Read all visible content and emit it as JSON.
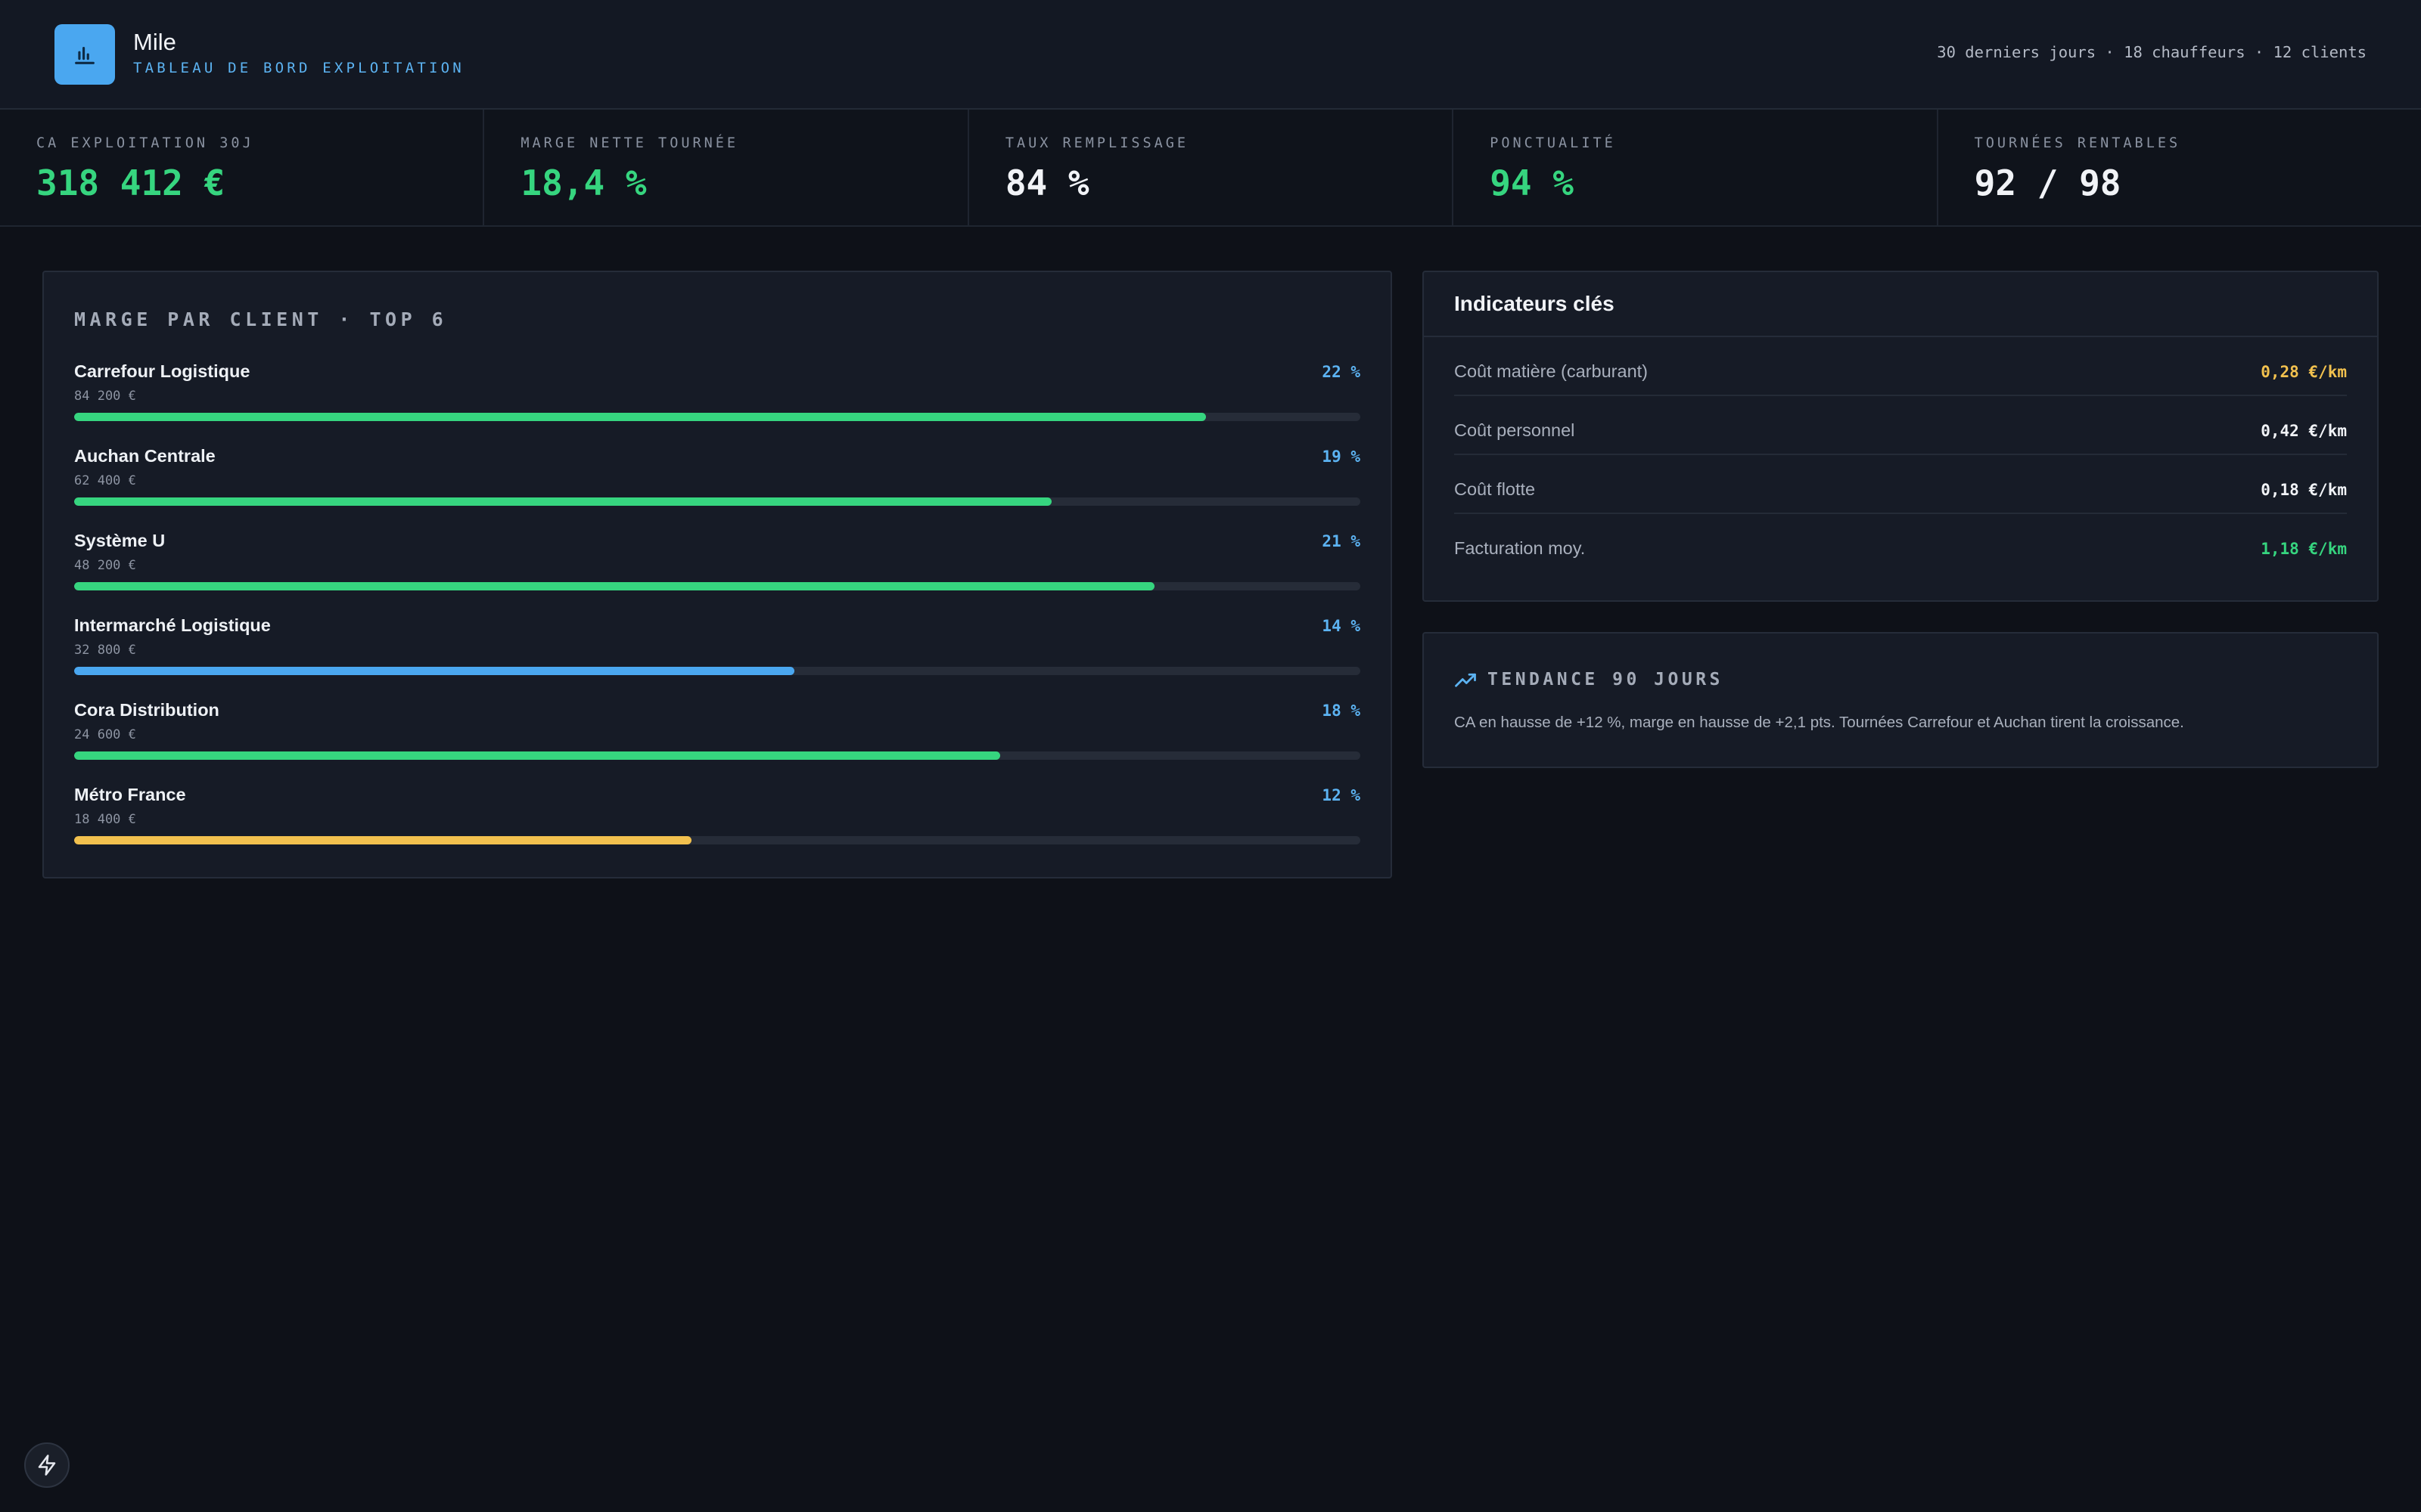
{
  "header": {
    "app_name": "Mile",
    "subtitle": "TABLEAU DE BORD EXPLOITATION",
    "meta": "30 derniers jours · 18 chauffeurs · 12 clients",
    "logo_icon": "bar-chart-icon"
  },
  "kpis": [
    {
      "label": "CA EXPLOITATION 30J",
      "value": "318 412 €",
      "accent": true
    },
    {
      "label": "MARGE NETTE TOURNÉE",
      "value": "18,4 %",
      "accent": true
    },
    {
      "label": "TAUX REMPLISSAGE",
      "value": "84 %",
      "accent": false
    },
    {
      "label": "PONCTUALITÉ",
      "value": "94 %",
      "accent": true
    },
    {
      "label": "TOURNÉES RENTABLES",
      "value": "92 / 98",
      "accent": false
    }
  ],
  "margin_panel": {
    "title": "MARGE PAR CLIENT · TOP 6",
    "clients": [
      {
        "name": "Carrefour Logistique",
        "amount": "84 200 €",
        "pct": "22 %",
        "level": 0.88,
        "color": "#36d57f"
      },
      {
        "name": "Auchan Centrale",
        "amount": "62 400 €",
        "pct": "19 %",
        "level": 0.76,
        "color": "#36d57f"
      },
      {
        "name": "Système U",
        "amount": "48 200 €",
        "pct": "21 %",
        "level": 0.84,
        "color": "#36d57f"
      },
      {
        "name": "Intermarché Logistique",
        "amount": "32 800 €",
        "pct": "14 %",
        "level": 0.56,
        "color": "#4aa7f0"
      },
      {
        "name": "Cora Distribution",
        "amount": "24 600 €",
        "pct": "18 %",
        "level": 0.72,
        "color": "#36d57f"
      },
      {
        "name": "Métro France",
        "amount": "18 400 €",
        "pct": "12 %",
        "level": 0.48,
        "color": "#f2c14e"
      }
    ]
  },
  "indicators": {
    "title": "Indicateurs clés",
    "rows": [
      {
        "label": "Coût matière (carburant)",
        "value": "0,28 €/km",
        "color": "#f2c14e"
      },
      {
        "label": "Coût personnel",
        "value": "0,42 €/km",
        "color": "#f1f3f7"
      },
      {
        "label": "Coût flotte",
        "value": "0,18 €/km",
        "color": "#f1f3f7"
      },
      {
        "label": "Facturation moy.",
        "value": "1,18 €/km",
        "color": "#36d57f"
      }
    ]
  },
  "trend": {
    "title": "TENDANCE 90 JOURS",
    "text": "CA en hausse de +12 %, marge en hausse de +2,1 pts. Tournées Carrefour et Auchan tirent la croissance.",
    "icon": "trending-up-icon"
  },
  "colors": {
    "green": "#36d57f",
    "blue": "#4aa7f0",
    "yellow": "#f2c14e",
    "background": "#0e1118"
  },
  "corner_icon": "lightning-icon"
}
